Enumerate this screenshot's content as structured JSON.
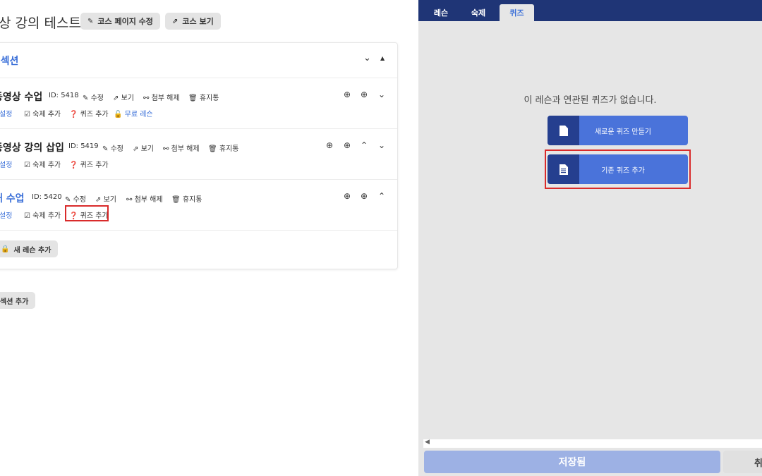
{
  "left_panel": {
    "page_title": "상 강의 테스트",
    "header_buttons": {
      "edit_course_page": "코스 페이지 수정",
      "view_course": "코스 보기"
    },
    "section": {
      "title": "l 섹션",
      "lessons": [
        {
          "title": "동영상 수업",
          "id_text": "ID: 5418",
          "actions": [
            "수정",
            "보기",
            "첨부 해제",
            "휴지통"
          ],
          "sub_actions": [
            "설정",
            "숙제 추가",
            "퀴즈 추가",
            "무료 레슨"
          ]
        },
        {
          "title": "동영상 강의 삽입",
          "id_text": "ID: 5419",
          "actions": [
            "수정",
            "보기",
            "첨부 해제",
            "휴지통"
          ],
          "sub_actions": [
            "설정",
            "숙제 추가",
            "퀴즈 추가"
          ]
        },
        {
          "title": "새 수업",
          "id_text": "ID: 5420",
          "actions": [
            "수정",
            "보기",
            "첨부 해제",
            "휴지통"
          ],
          "sub_actions": [
            "설정",
            "숙제 추가",
            "퀴즈 추가"
          ]
        }
      ],
      "add_lesson_label": "새 레슨 추가"
    },
    "add_section_label": "섹션 추가"
  },
  "right_panel": {
    "tabs": [
      "레슨",
      "숙제",
      "퀴즈"
    ],
    "active_tab": "퀴즈",
    "empty_message": "이 레슨과 연관된 퀴즈가 없습니다.",
    "new_quiz_button": "새로운 퀴즈 만들기",
    "existing_quiz_button": "기존 퀴즈 추가",
    "save_button": "저장됨",
    "cut_off_button": "취"
  },
  "colors": {
    "accent_blue": "#3a6fd8",
    "top_bar": "#1f3576",
    "quiz_button": "#4a73da",
    "quiz_icon_box": "#253f8f",
    "save_button": "#9db1e4",
    "highlight_red": "#d92b2b"
  },
  "icons": {
    "edit": "edit-icon",
    "external": "external-link-icon",
    "unlink": "unlink-icon",
    "trash": "trash-icon",
    "check": "check-square-icon",
    "question": "question-circle-icon",
    "unlock": "unlock-icon",
    "document": "document-icon"
  }
}
